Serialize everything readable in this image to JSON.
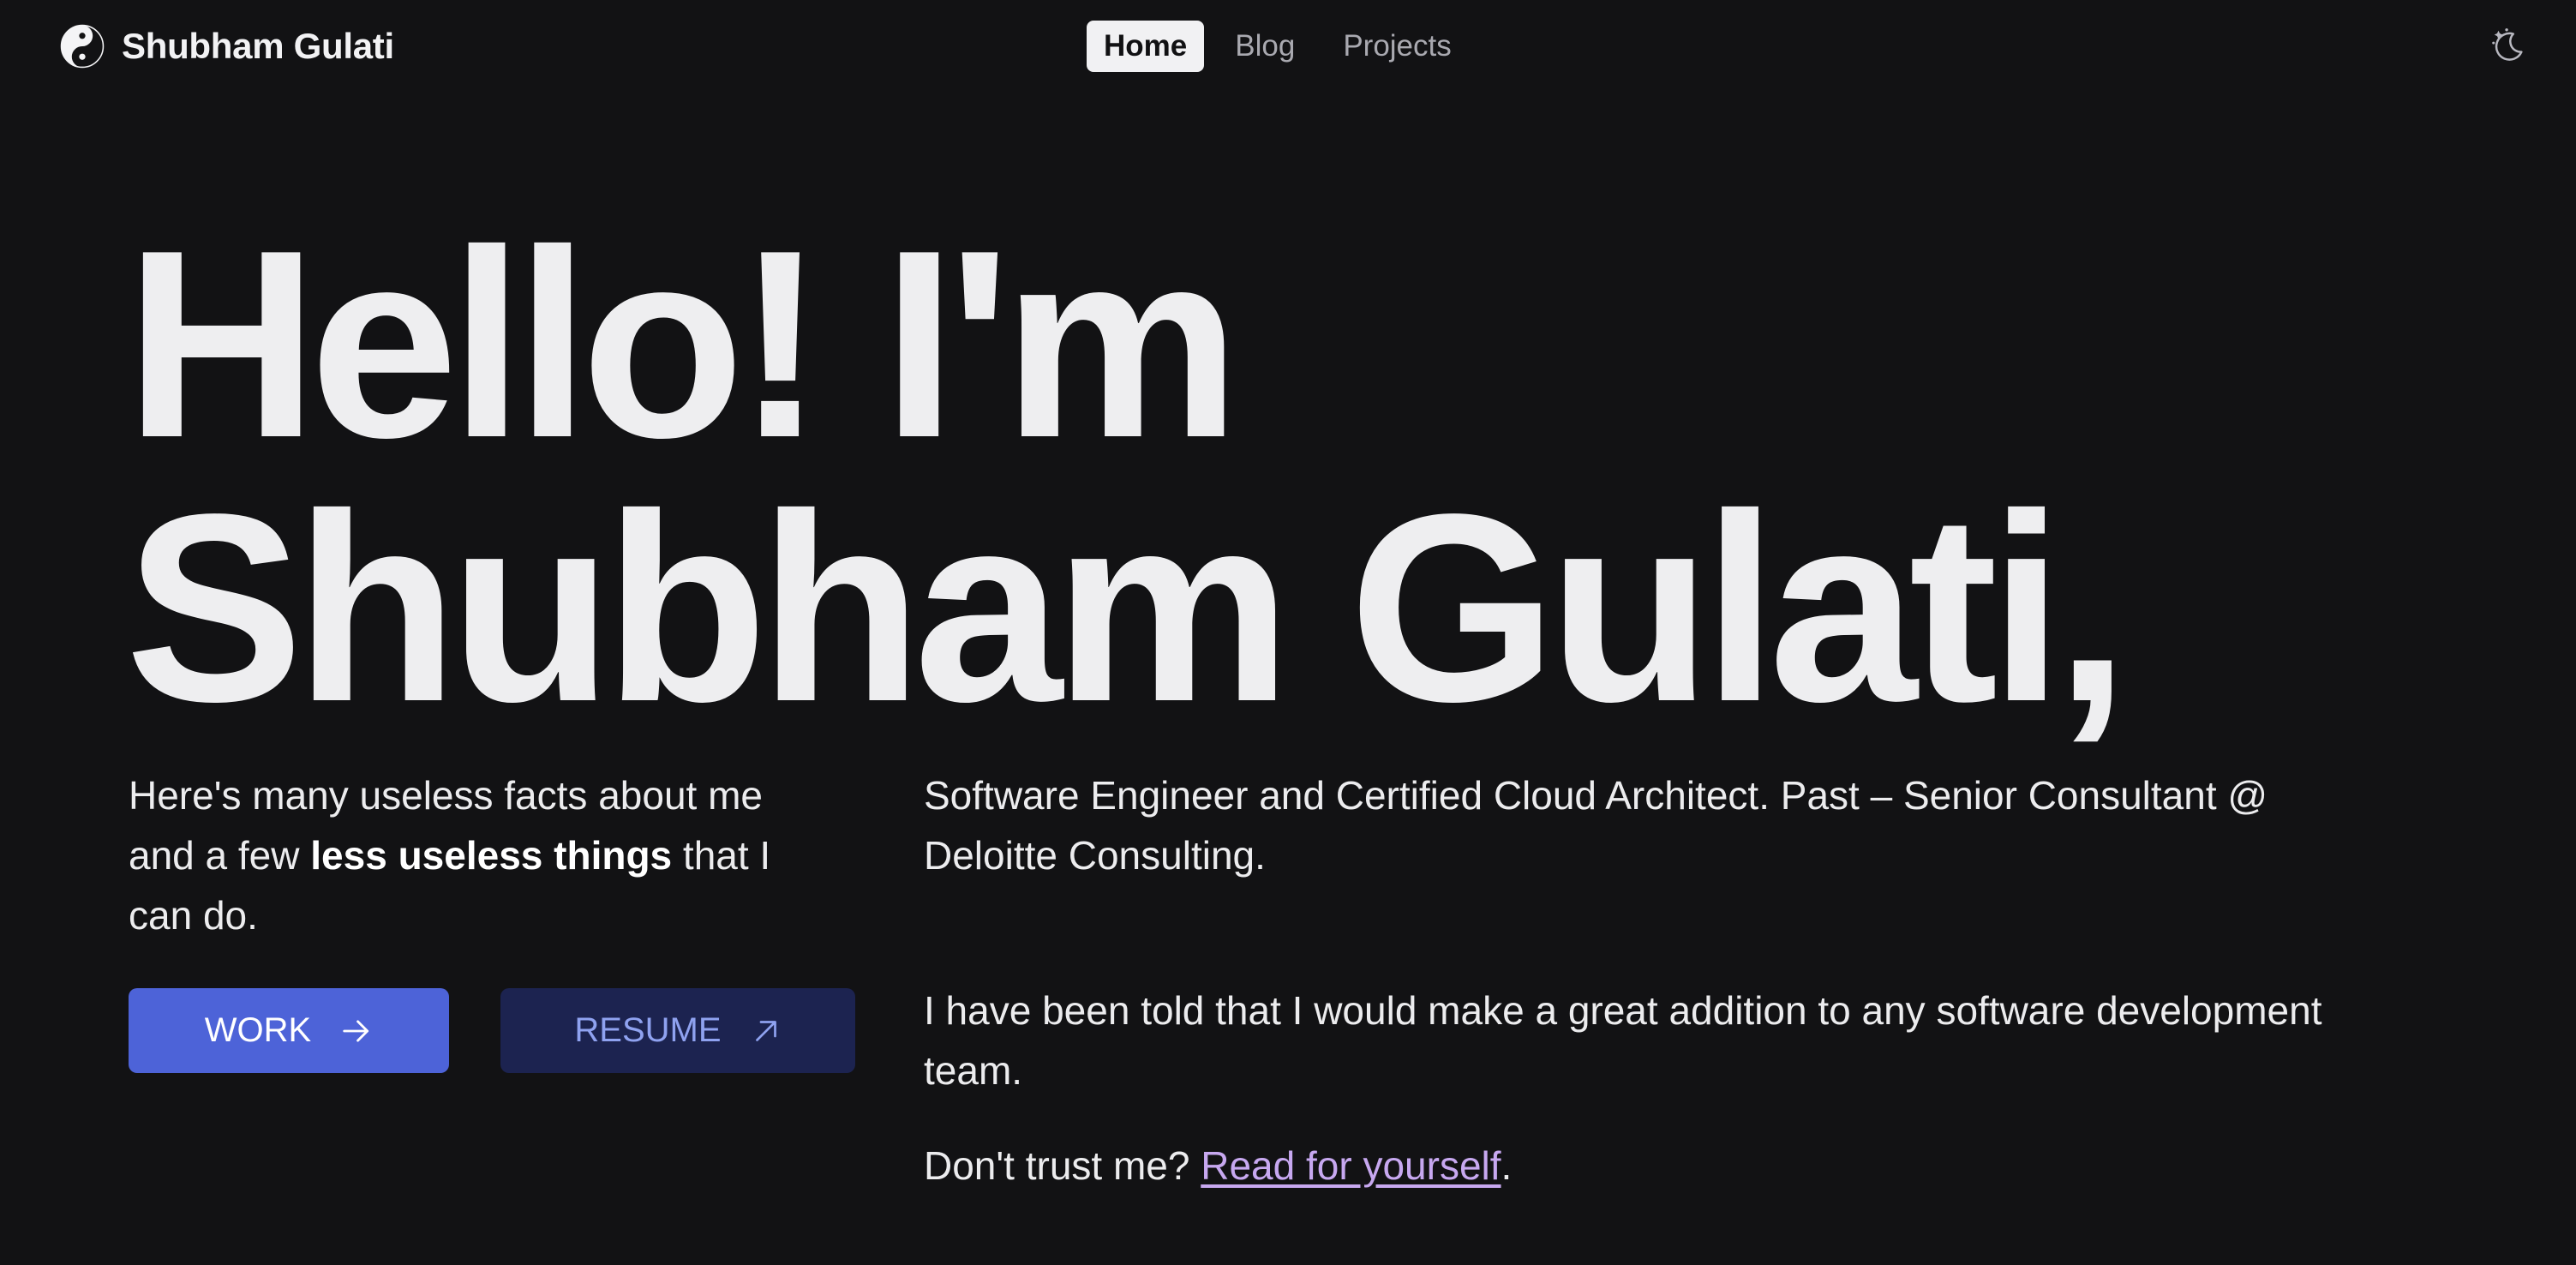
{
  "header": {
    "brand_name": "Shubham Gulati",
    "nav": [
      {
        "label": "Home",
        "active": true
      },
      {
        "label": "Blog",
        "active": false
      },
      {
        "label": "Projects",
        "active": false
      }
    ],
    "theme_icon": "moon-stars-icon"
  },
  "hero": {
    "line1": "Hello! I'm",
    "line2": "Shubham Gulati,"
  },
  "intro": {
    "before": "Here's many useless facts about me and a few ",
    "bold": "less useless things",
    "after": " that I can do."
  },
  "buttons": {
    "work_label": "WORK",
    "resume_label": "RESUME"
  },
  "about": {
    "p1": "Software Engineer and Certified Cloud Architect. Past – Senior Consultant @ Deloitte Consulting.",
    "p2": "I have been told that I would make a great addition to any software development team.",
    "p3_before": "Don't trust me? ",
    "p3_link": "Read for yourself",
    "p3_after": "."
  },
  "colors": {
    "background": "#121214",
    "work_button": "#4d63d8",
    "resume_button": "#1c2350",
    "link": "#c7a8f0"
  }
}
